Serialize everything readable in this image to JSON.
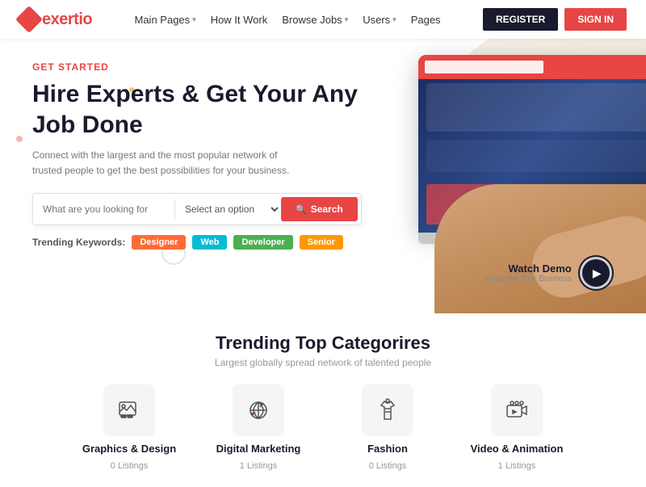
{
  "navbar": {
    "logo_text": "xertio",
    "logo_prefix": "e",
    "links": [
      {
        "label": "Main Pages",
        "has_dropdown": true
      },
      {
        "label": "How It Work",
        "has_dropdown": false
      },
      {
        "label": "Browse Jobs",
        "has_dropdown": true
      },
      {
        "label": "Users",
        "has_dropdown": true
      },
      {
        "label": "Pages",
        "has_dropdown": false
      }
    ],
    "register_label": "REGISTER",
    "signin_label": "SIGN IN"
  },
  "hero": {
    "get_started": "GET STARTED",
    "title_line1": "Hire Experts & Get Your Any",
    "title_line2": "Job Done",
    "subtitle": "Connect with the largest and the most popular network of trusted people to get the best possibilities for your business.",
    "search": {
      "placeholder": "What are you looking for",
      "select_placeholder": "Select an option",
      "button_label": "Search"
    },
    "trending": {
      "label": "Trending Keywords:",
      "tags": [
        {
          "label": "Designer",
          "color": "orange"
        },
        {
          "label": "Web",
          "color": "cyan"
        },
        {
          "label": "Developer",
          "color": "green"
        },
        {
          "label": "Senior",
          "color": "yellow"
        }
      ]
    },
    "watch_demo": {
      "title": "Watch Demo",
      "subtitle": "Jumpstart Your Business"
    }
  },
  "categories": {
    "title": "Trending Top Categorires",
    "subtitle": "Largest globally spread network of talented people",
    "items": [
      {
        "name": "Graphics & Design",
        "count": "0 Listings",
        "icon": "graphics"
      },
      {
        "name": "Digital Marketing",
        "count": "1 Listings",
        "icon": "marketing"
      },
      {
        "name": "Fashion",
        "count": "0 Listings",
        "icon": "fashion"
      },
      {
        "name": "Video & Animation",
        "count": "1 Listings",
        "icon": "video"
      }
    ]
  }
}
